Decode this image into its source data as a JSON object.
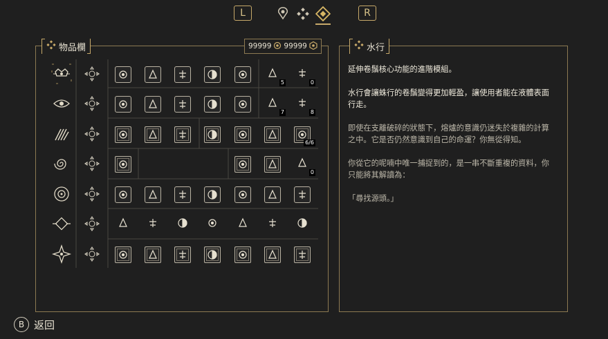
{
  "nav": {
    "left_button": "L",
    "right_button": "R",
    "tabs": [
      {
        "icon": "map-pin-icon"
      },
      {
        "icon": "diamonds-icon"
      },
      {
        "icon": "diamond-selected-icon",
        "selected": true
      }
    ]
  },
  "inventory": {
    "title": "物品欄",
    "currency": [
      {
        "value": "99999",
        "icon": "gear-coin-icon"
      },
      {
        "value": "99999",
        "icon": "hex-coin-icon"
      }
    ],
    "rows": [
      {
        "row_icon": "crown-sigil-icon",
        "level_icon": "level-0-icon",
        "items": [
          {
            "icon": "eye-glyph-icon"
          },
          {
            "icon": "skull-glyph-icon"
          },
          {
            "icon": "tree-glyph-icon"
          },
          {
            "icon": "half-moon-glyph-icon"
          },
          {
            "icon": "brain-glyph-icon"
          }
        ],
        "extras": [
          {
            "icon": "stack-eye-icon",
            "count": "5"
          },
          {
            "icon": "split-circle-icon",
            "count": "0"
          }
        ]
      },
      {
        "row_icon": "eye-sigil-icon",
        "level_icon": "level-1-icon",
        "items": [
          {
            "icon": "eye-glyph-icon"
          },
          {
            "icon": "skull-glyph-icon"
          },
          {
            "icon": "tree-glyph-icon"
          },
          {
            "icon": "half-moon-glyph-icon"
          },
          {
            "icon": "brain-glyph-icon"
          }
        ],
        "extras": [
          {
            "icon": "four-dots-icon",
            "count": "7"
          },
          {
            "icon": "hex-eye-icon",
            "count": "8"
          }
        ]
      },
      {
        "row_icon": "claw-sigil-icon",
        "level_icon": "level-2-icon",
        "items": [
          {
            "icon": "flower-glyph-icon"
          },
          {
            "icon": "arrow-glyph-icon"
          },
          {
            "icon": "spiral-glyph-icon"
          }
        ],
        "extras_mid": [
          {
            "icon": "hex-bug-icon"
          },
          {
            "icon": "diamond-eye-icon"
          },
          {
            "icon": "arch-icon"
          }
        ],
        "extras": [
          {
            "icon": "grid-icon",
            "count": "6/6"
          }
        ]
      },
      {
        "row_icon": "spiral-sigil-icon",
        "level_icon": "level-3-icon",
        "items": [
          {
            "icon": "sword-glyph-icon"
          }
        ],
        "extras_mid": [
          {
            "icon": "sun-glyph-icon"
          },
          {
            "icon": "hexagon-gem-icon"
          }
        ],
        "extras": [
          {
            "icon": "hex-lock-icon",
            "count": "0"
          }
        ]
      },
      {
        "row_icon": "ring-sigil-icon",
        "level_icon": "level-4-icon",
        "items": [
          {
            "icon": "rings-icon"
          },
          {
            "icon": "wheat-icon"
          },
          {
            "icon": "mask-icon"
          },
          {
            "icon": "dice-icon"
          },
          {
            "icon": "pencil-icon"
          },
          {
            "icon": "music-note-icon"
          },
          {
            "icon": "bandage-icon"
          }
        ]
      },
      {
        "row_icon": "diamond-sigil-icon",
        "level_icon": "level-5-icon",
        "items": [
          {
            "icon": "rune-xi-icon"
          },
          {
            "icon": "rune-psi-icon"
          },
          {
            "icon": "rune-sigma-icon"
          },
          {
            "icon": "rune-delta-icon"
          },
          {
            "icon": "rune-e-icon"
          },
          {
            "icon": "rune-n-icon"
          },
          {
            "icon": "rune-u-icon"
          }
        ]
      },
      {
        "row_icon": "star-sigil-icon",
        "level_icon": "level-6-icon",
        "items": [
          {
            "icon": "banner-a-icon"
          },
          {
            "icon": "banner-b-icon"
          },
          {
            "icon": "banner-c-icon"
          },
          {
            "icon": "banner-d-icon"
          },
          {
            "icon": "banner-e-icon"
          },
          {
            "icon": "banner-f-icon"
          },
          {
            "icon": "banner-g-icon"
          }
        ]
      }
    ]
  },
  "detail": {
    "title": "水行",
    "paragraphs": [
      {
        "text": "延伸卷鬚核心功能的進階模組。",
        "dim": false
      },
      {
        "text": "水行會讓蛛行的卷鬚變得更加輕盈，讓使用者能在液體表面行走。",
        "dim": false
      },
      {
        "text": "即使在支離破碎的狀態下，熔爐的意識仍迷失於複雜的計算之中。它是否仍然意識到自己的命運？你無從得知。",
        "dim": true
      },
      {
        "text": "你從它的呢喃中唯一捕捉到的，是一串不斷重複的資料，你只能將其解讀為：",
        "dim": true
      },
      {
        "text": "「尋找源頭。」",
        "dim": true
      }
    ]
  },
  "footer": {
    "back_button": "B",
    "back_label": "返回"
  },
  "colors": {
    "accent": "#c8aa6a",
    "background": "#1f1f1f",
    "text": "#e8e2d2"
  }
}
